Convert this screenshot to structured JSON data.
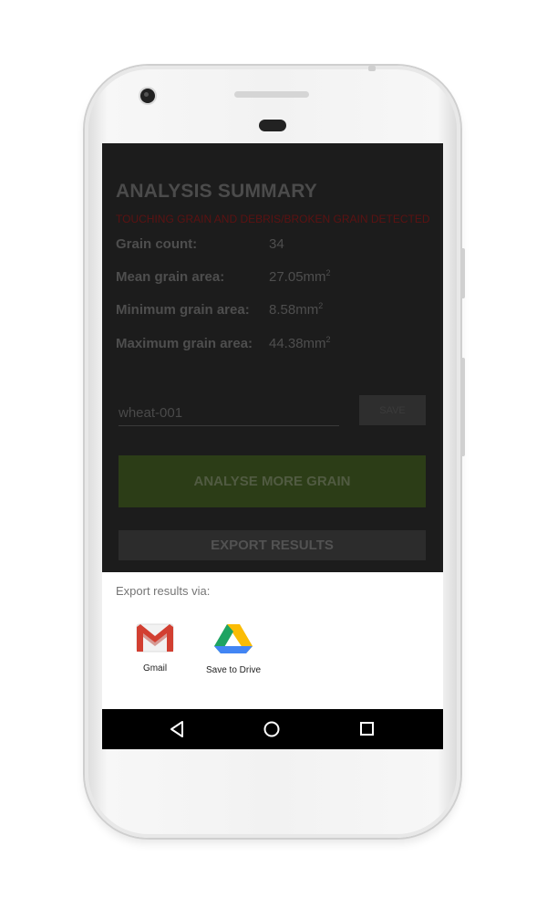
{
  "summary": {
    "title": "ANALYSIS SUMMARY",
    "warning": "TOUCHING GRAIN AND DEBRIS/BROKEN GRAIN DETECTED",
    "stats": [
      {
        "label": "Grain count:",
        "value": "34",
        "unit": ""
      },
      {
        "label": "Mean grain area:",
        "value": "27.05mm",
        "unit": "2"
      },
      {
        "label": "Minimum grain area:",
        "value": "8.58mm",
        "unit": "2"
      },
      {
        "label": "Maximum grain area:",
        "value": "44.38mm",
        "unit": "2"
      }
    ]
  },
  "save": {
    "name_value": "wheat-001",
    "save_label": "SAVE"
  },
  "actions": {
    "analyse_label": "ANALYSE MORE GRAIN",
    "export_label": "EXPORT RESULTS"
  },
  "share_sheet": {
    "title": "Export results via:",
    "targets": [
      {
        "label": "Gmail",
        "icon": "gmail-icon"
      },
      {
        "label": "Save to Drive",
        "icon": "google-drive-icon"
      }
    ]
  },
  "navigation": {
    "back": "back-icon",
    "home": "home-icon",
    "recents": "recents-icon"
  },
  "colors": {
    "analyse_button": "#2c3d17",
    "warning_text": "#5c1212",
    "screen_background": "#1c1c1c"
  }
}
